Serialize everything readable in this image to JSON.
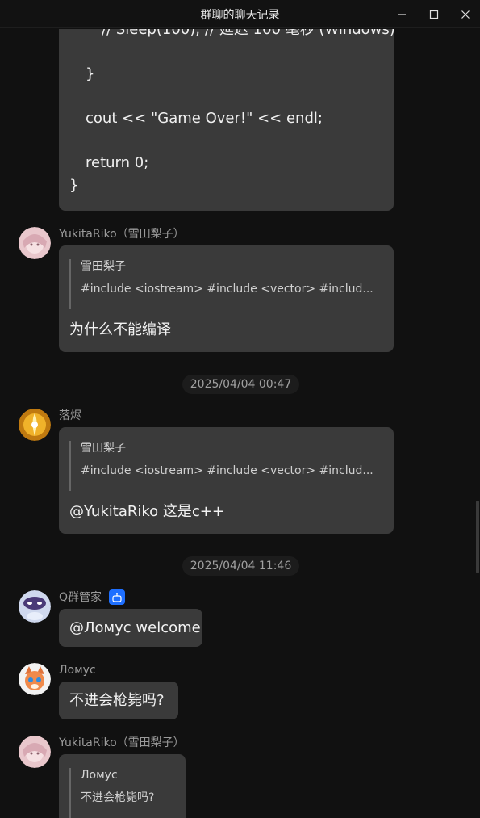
{
  "window": {
    "title": "群聊的聊天记录"
  },
  "code_message": {
    "lines": [
      "// Sleep(100); // 延迟 100 毫秒 (Windows)",
      "}",
      "cout << \"Game Over!\" << endl;",
      "return 0;",
      "}"
    ]
  },
  "messages": [
    {
      "sender": "YukitaRiko（雪田梨子）",
      "quote_name": "雪田梨子",
      "quote_text": "#include <iostream> #include <vector> #includ...",
      "text": "为什么不能编译"
    },
    {
      "sender": "落烬",
      "quote_name": "雪田梨子",
      "quote_text": "#include <iostream> #include <vector> #includ...",
      "text": "@YukitaRiko 这是c++"
    },
    {
      "sender": "Q群管家",
      "text": "@Ломус welcome"
    },
    {
      "sender": "Ломус",
      "text": "不进会枪毙吗?"
    },
    {
      "sender": "YukitaRiko（雪田梨子）",
      "quote_name": "Ломус",
      "quote_text": "不进会枪毙吗?"
    }
  ],
  "timestamps": [
    "2025/04/04 00:47",
    "2025/04/04 11:46"
  ],
  "icons": {
    "minimize": "minimize-icon",
    "maximize": "maximize-icon",
    "close": "close-icon",
    "bot_badge": "robot-badge-icon"
  },
  "colors": {
    "background": "#111111",
    "bubble": "#3a3a3a",
    "bot_badge": "#1e6fff"
  }
}
